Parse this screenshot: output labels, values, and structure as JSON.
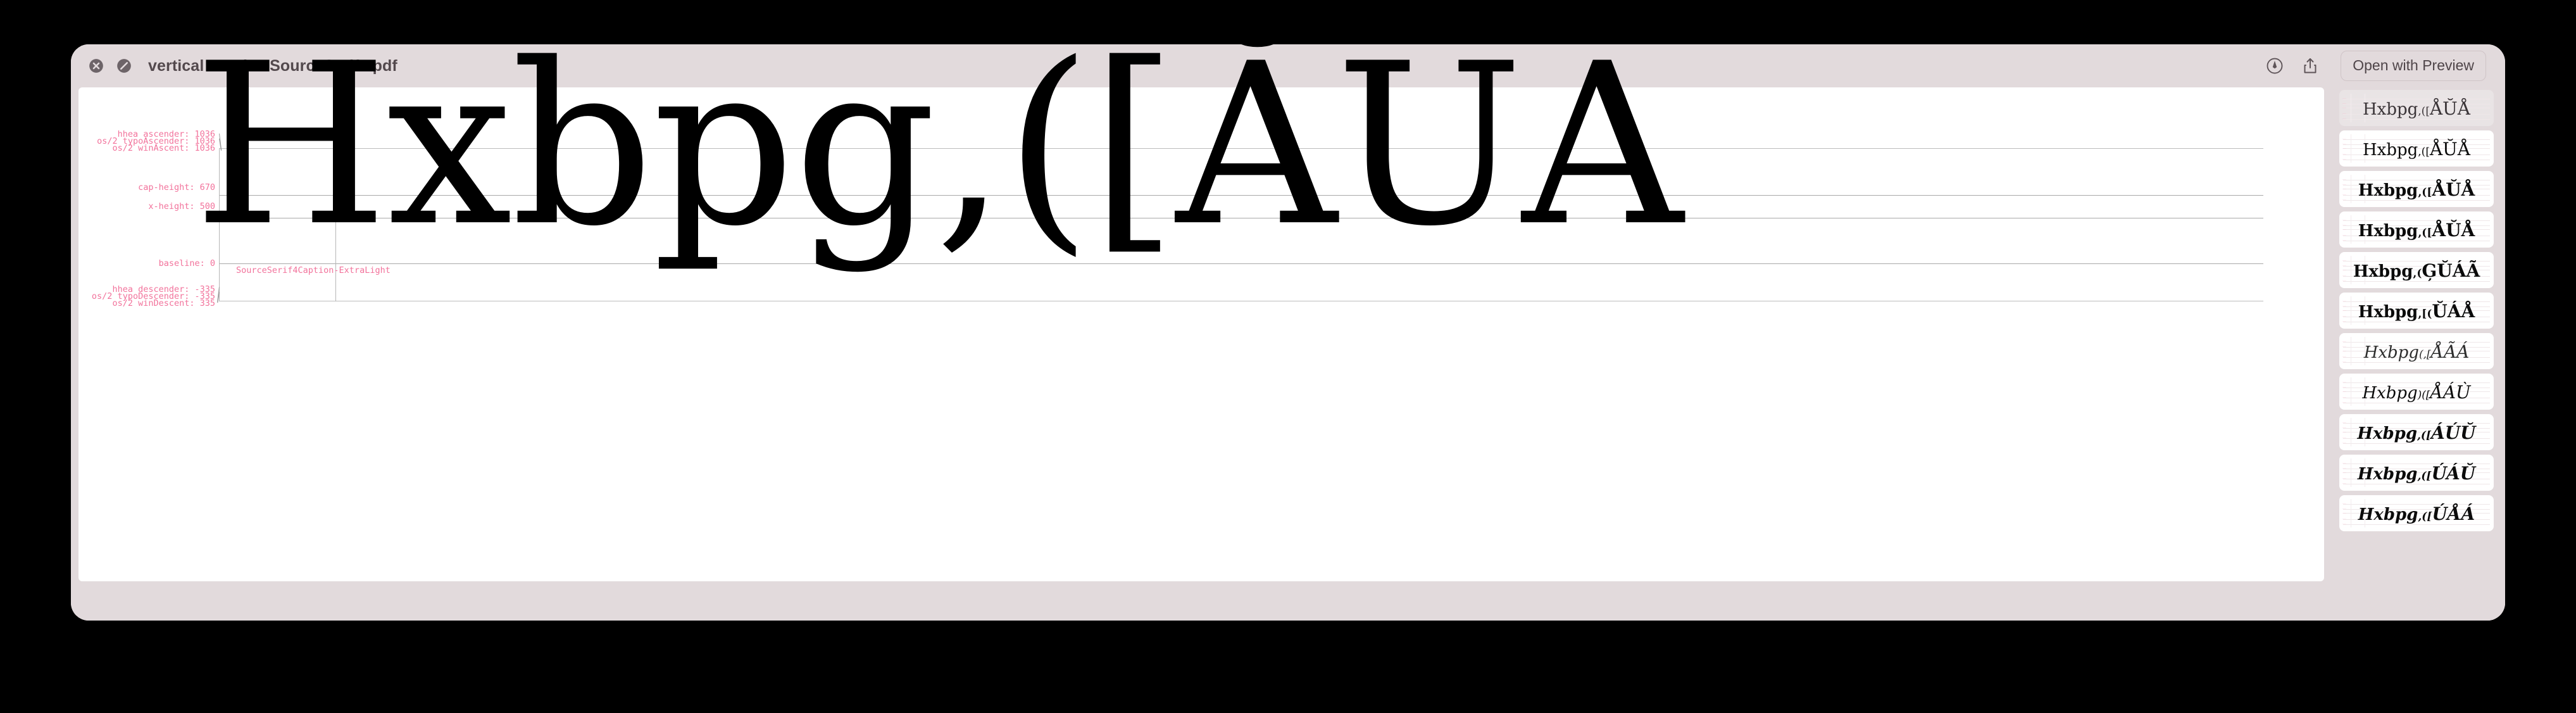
{
  "window": {
    "title": "vertical metrics SourceSerif4.pdf",
    "titlebar_color": "#e2dadc",
    "icons": {
      "close": "close-circle-icon",
      "block": "no-entry-icon",
      "markup": "markup-pen-icon",
      "share": "share-icon"
    },
    "open_with_button": "Open with Preview"
  },
  "document": {
    "font_name_label": "SourceSerif4Caption-ExtraLight",
    "specimen_text": "Hxbpg,([ĂŬẢ",
    "accent_color": "#f2729b",
    "metrics": [
      {
        "id": "hhea-ascender",
        "label": "hhea ascender: 1036",
        "value": 1036
      },
      {
        "id": "typo-ascender",
        "label": "os/2 typoAscender: 1036",
        "value": 1036
      },
      {
        "id": "win-ascent",
        "label": "os/2 winAscent: 1036",
        "value": 1036
      },
      {
        "id": "cap-height",
        "label": "cap-height: 670",
        "value": 670
      },
      {
        "id": "x-height",
        "label": "x-height: 500",
        "value": 500
      },
      {
        "id": "baseline",
        "label": "baseline: 0",
        "value": 0
      },
      {
        "id": "hhea-descender",
        "label": "hhea descender: -335",
        "value": -335
      },
      {
        "id": "typo-descender",
        "label": "os/2 typoDescender: -335",
        "value": -335
      },
      {
        "id": "win-descent",
        "label": "os/2 winDescent: 335",
        "value": 335
      }
    ]
  },
  "thumbnails": [
    {
      "index": 1,
      "text": "Hxbpg,([",
      "accents": "ÅŬÅ",
      "weight": "w-light",
      "style": "",
      "selected": true
    },
    {
      "index": 2,
      "text": "Hxbpg,([",
      "accents": "ÅŬÅ",
      "weight": "w-regular",
      "style": "",
      "selected": false
    },
    {
      "index": 3,
      "text": "Hxbpg,([",
      "accents": "ÅŬÅ",
      "weight": "w-semibold",
      "style": "",
      "selected": false
    },
    {
      "index": 4,
      "text": "Hxbpg,([",
      "accents": "ÅŬÅ",
      "weight": "w-bold",
      "style": "",
      "selected": false
    },
    {
      "index": 5,
      "text": "Hxbpg,(",
      "accents": "ĢŬÁÃ",
      "weight": "w-bold",
      "style": "",
      "selected": false
    },
    {
      "index": 6,
      "text": "Hxbpg,[(",
      "accents": "ŬÁÅ",
      "weight": "w-black",
      "style": "",
      "selected": false
    },
    {
      "index": 7,
      "text": "Hxbpg(,[",
      "accents": "ÅÃÁ",
      "weight": "w-light",
      "style": "s-italic",
      "selected": false
    },
    {
      "index": 8,
      "text": "Hxbpg)([",
      "accents": "ÅÁÙ",
      "weight": "w-regular",
      "style": "s-italic",
      "selected": false
    },
    {
      "index": 9,
      "text": "Hxbpg,([",
      "accents": "ÁÚŬ",
      "weight": "w-semibold",
      "style": "s-italic",
      "selected": false
    },
    {
      "index": 10,
      "text": "Hxbpg,([",
      "accents": "ÚÁŬ",
      "weight": "w-bold",
      "style": "s-italic",
      "selected": false
    },
    {
      "index": 11,
      "text": "Hxbpg,([",
      "accents": "ÚÅÁ",
      "weight": "w-black",
      "style": "s-italic",
      "selected": false
    }
  ]
}
